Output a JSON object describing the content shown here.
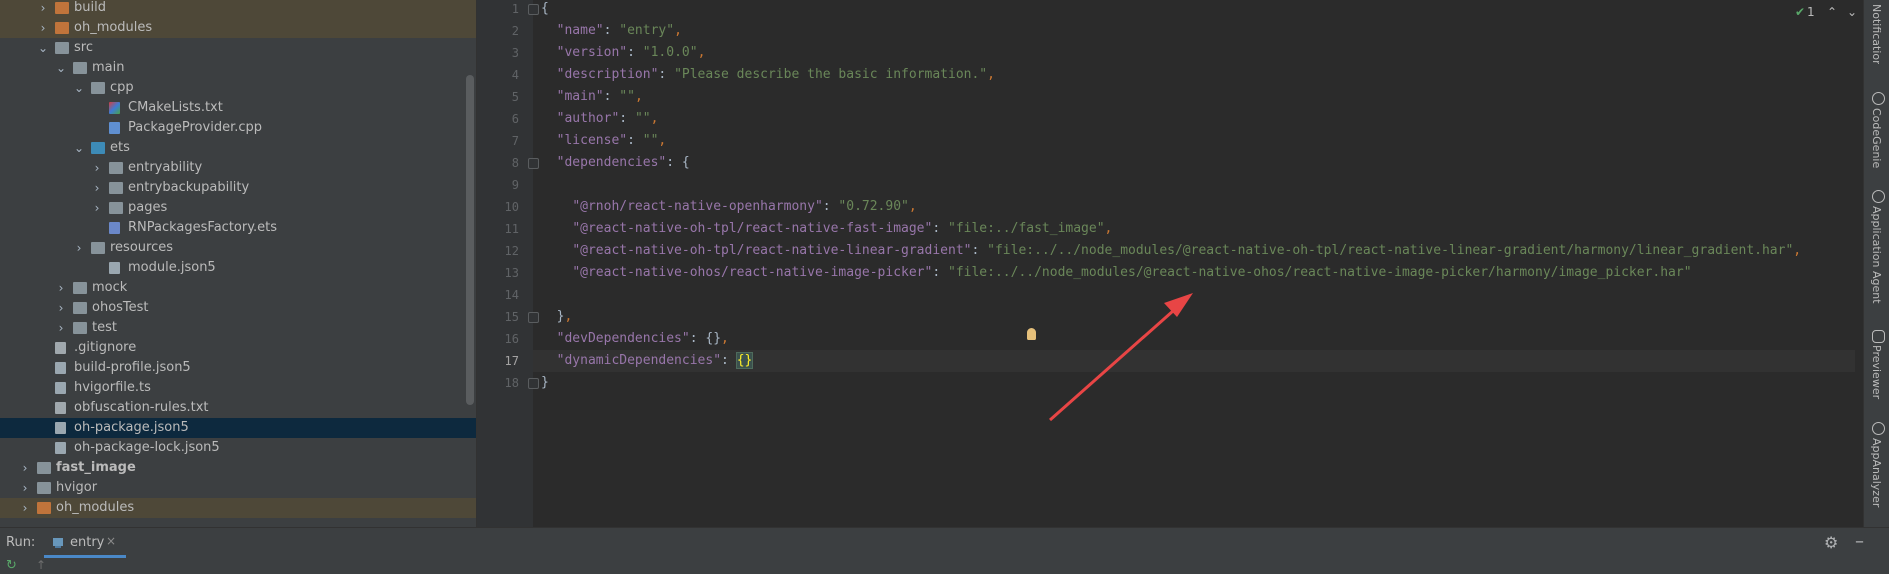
{
  "project_tree": {
    "items": [
      {
        "label": "build",
        "icon": "folder-orange-icon",
        "arrow": "›",
        "style": "yellow"
      },
      {
        "label": "oh_modules",
        "icon": "folder-orange-icon",
        "arrow": "›",
        "style": "yellow"
      },
      {
        "label": "src",
        "icon": "folder-icon",
        "arrow": "⌄",
        "style": ""
      },
      {
        "label": "main",
        "icon": "folder-icon",
        "arrow": "⌄",
        "style": ""
      },
      {
        "label": "cpp",
        "icon": "folder-icon",
        "arrow": "⌄",
        "style": ""
      },
      {
        "label": "CMakeLists.txt",
        "icon": "cmake-file-icon",
        "arrow": "",
        "style": ""
      },
      {
        "label": "PackageProvider.cpp",
        "icon": "cpp-file-icon",
        "arrow": "",
        "style": ""
      },
      {
        "label": "ets",
        "icon": "folder-blue-icon",
        "arrow": "⌄",
        "style": ""
      },
      {
        "label": "entryability",
        "icon": "folder-icon",
        "arrow": "›",
        "style": ""
      },
      {
        "label": "entrybackupability",
        "icon": "folder-icon",
        "arrow": "›",
        "style": ""
      },
      {
        "label": "pages",
        "icon": "folder-icon",
        "arrow": "›",
        "style": ""
      },
      {
        "label": "RNPackagesFactory.ets",
        "icon": "ets-file-icon",
        "arrow": "",
        "style": ""
      },
      {
        "label": "resources",
        "icon": "folder-icon",
        "arrow": "›",
        "style": ""
      },
      {
        "label": "module.json5",
        "icon": "json-file-icon",
        "arrow": "",
        "style": ""
      },
      {
        "label": "mock",
        "icon": "folder-icon",
        "arrow": "›",
        "style": ""
      },
      {
        "label": "ohosTest",
        "icon": "folder-icon",
        "arrow": "›",
        "style": ""
      },
      {
        "label": "test",
        "icon": "folder-icon",
        "arrow": "›",
        "style": ""
      },
      {
        "label": ".gitignore",
        "icon": "file-icon",
        "arrow": "",
        "style": ""
      },
      {
        "label": "build-profile.json5",
        "icon": "json-file-icon",
        "arrow": "",
        "style": ""
      },
      {
        "label": "hvigorfile.ts",
        "icon": "ts-file-icon",
        "arrow": "",
        "style": ""
      },
      {
        "label": "obfuscation-rules.txt",
        "icon": "file-icon",
        "arrow": "",
        "style": ""
      },
      {
        "label": "oh-package.json5",
        "icon": "json-file-icon",
        "arrow": "",
        "style": "selected"
      },
      {
        "label": "oh-package-lock.json5",
        "icon": "json-file-icon",
        "arrow": "",
        "style": ""
      },
      {
        "label": "fast_image",
        "icon": "module-folder-icon",
        "arrow": "›",
        "style": ""
      },
      {
        "label": "hvigor",
        "icon": "folder-icon",
        "arrow": "›",
        "style": ""
      },
      {
        "label": "oh_modules",
        "icon": "folder-orange-icon",
        "arrow": "›",
        "style": "yellow"
      }
    ]
  },
  "editor": {
    "inspection": {
      "count": "1",
      "check_icon": "check-icon",
      "up_icon": "chevron-up-icon",
      "down_icon": "chevron-down-icon"
    },
    "current_line": "17",
    "lines": [
      {
        "n": "1",
        "code": "{"
      },
      {
        "n": "2",
        "code": "  \"name\": \"entry\","
      },
      {
        "n": "3",
        "code": "  \"version\": \"1.0.0\","
      },
      {
        "n": "4",
        "code": "  \"description\": \"Please describe the basic information.\","
      },
      {
        "n": "5",
        "code": "  \"main\": \"\","
      },
      {
        "n": "6",
        "code": "  \"author\": \"\","
      },
      {
        "n": "7",
        "code": "  \"license\": \"\","
      },
      {
        "n": "8",
        "code": "  \"dependencies\": {"
      },
      {
        "n": "9",
        "code": ""
      },
      {
        "n": "10",
        "code": "    \"@rnoh/react-native-openharmony\": \"0.72.90\","
      },
      {
        "n": "11",
        "code": "    \"@react-native-oh-tpl/react-native-fast-image\": \"file:../fast_image\","
      },
      {
        "n": "12",
        "code": "    \"@react-native-oh-tpl/react-native-linear-gradient\": \"file:../../node_modules/@react-native-oh-tpl/react-native-linear-gradient/harmony/linear_gradient.har\","
      },
      {
        "n": "13",
        "code": "    \"@react-native-ohos/react-native-image-picker\": \"file:../../node_modules/@react-native-ohos/react-native-image-picker/harmony/image_picker.har\""
      },
      {
        "n": "14",
        "code": ""
      },
      {
        "n": "15",
        "code": "  },"
      },
      {
        "n": "16",
        "code": "  \"devDependencies\": {},"
      },
      {
        "n": "17",
        "code": "  \"dynamicDependencies\": {}"
      },
      {
        "n": "18",
        "code": "}"
      }
    ]
  },
  "right_sidebar": {
    "tabs": [
      "Notifications",
      "CodeGenie",
      "Application Agent",
      "Previewer",
      "AppAnalyzer"
    ]
  },
  "run_bar": {
    "label": "Run:",
    "tab_label": "entry",
    "tab_close": "×",
    "settings_icon": "gear-icon",
    "minimize_icon": "minus-icon",
    "rerun_icon": "rerun-icon",
    "up_icon": "arrow-up-icon"
  },
  "colors": {
    "selection": "#0d293e",
    "accent_arrow": "#e84545",
    "key": "#9876aa",
    "string": "#6a8759"
  }
}
